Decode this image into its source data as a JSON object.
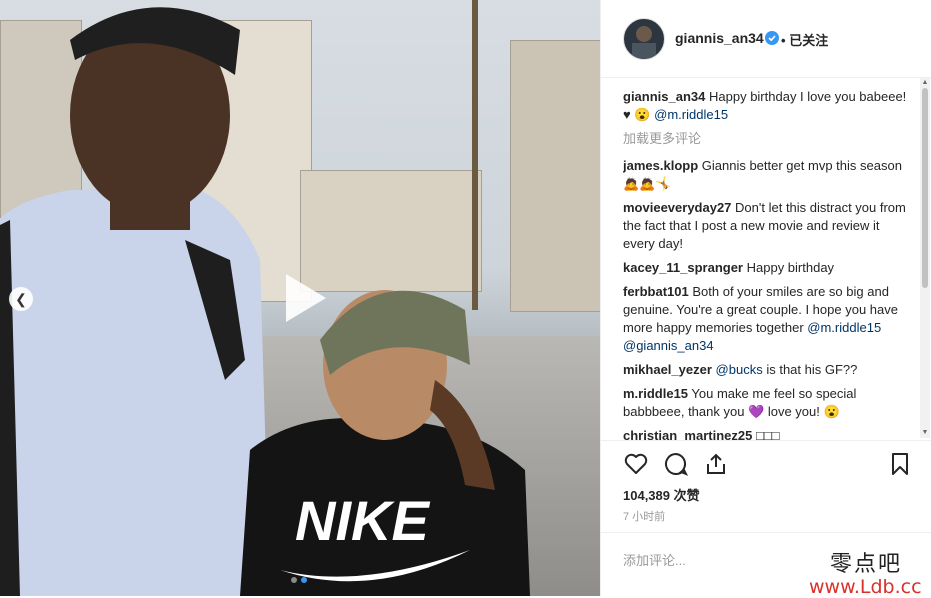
{
  "post": {
    "username": "giannis_an34",
    "follow_status": "已关注",
    "separator": "•"
  },
  "comments": [
    {
      "user": "giannis_an34",
      "text": "Happy birthday I love you babeee! ♥ 😮",
      "mention": "@m.riddle15"
    },
    {
      "user": "james.klopp",
      "text": "Giannis better get mvp this season 🙇🙇🤸",
      "mention": ""
    },
    {
      "user": "movieeveryday27",
      "text": "Don't let this distract you from the fact that I post a new movie and review it every day!",
      "mention": ""
    },
    {
      "user": "kacey_11_spranger",
      "text": "Happy birthday",
      "mention": ""
    },
    {
      "user": "ferbbat101",
      "text": "Both of your smiles are so big and genuine. You're a great couple. I hope you have more happy memories together",
      "mention": "@m.riddle15 @giannis_an34"
    },
    {
      "user": "mikhael_yezer",
      "text": "is that his GF??",
      "mention": "@bucks"
    },
    {
      "user": "m.riddle15",
      "text": "You make me feel so special babbbeee, thank you 💜 love you! 😮",
      "mention": ""
    },
    {
      "user": "christian_martinez25",
      "text": "□□□",
      "mention": ""
    }
  ],
  "load_more": "加载更多评论",
  "likes": "104,389 次赞",
  "time": "7 小时前",
  "add_comment_placeholder": "添加评论...",
  "watermark": {
    "line1": "零点吧",
    "line2": "www.Ldb.cc"
  },
  "icons": [
    "heart-icon",
    "comment-icon",
    "share-icon",
    "bookmark-icon",
    "play-icon",
    "chevron-left-icon",
    "verified-icon"
  ],
  "colors": {
    "accent": "#3897f0",
    "mention": "#003569",
    "muted": "#999999"
  }
}
